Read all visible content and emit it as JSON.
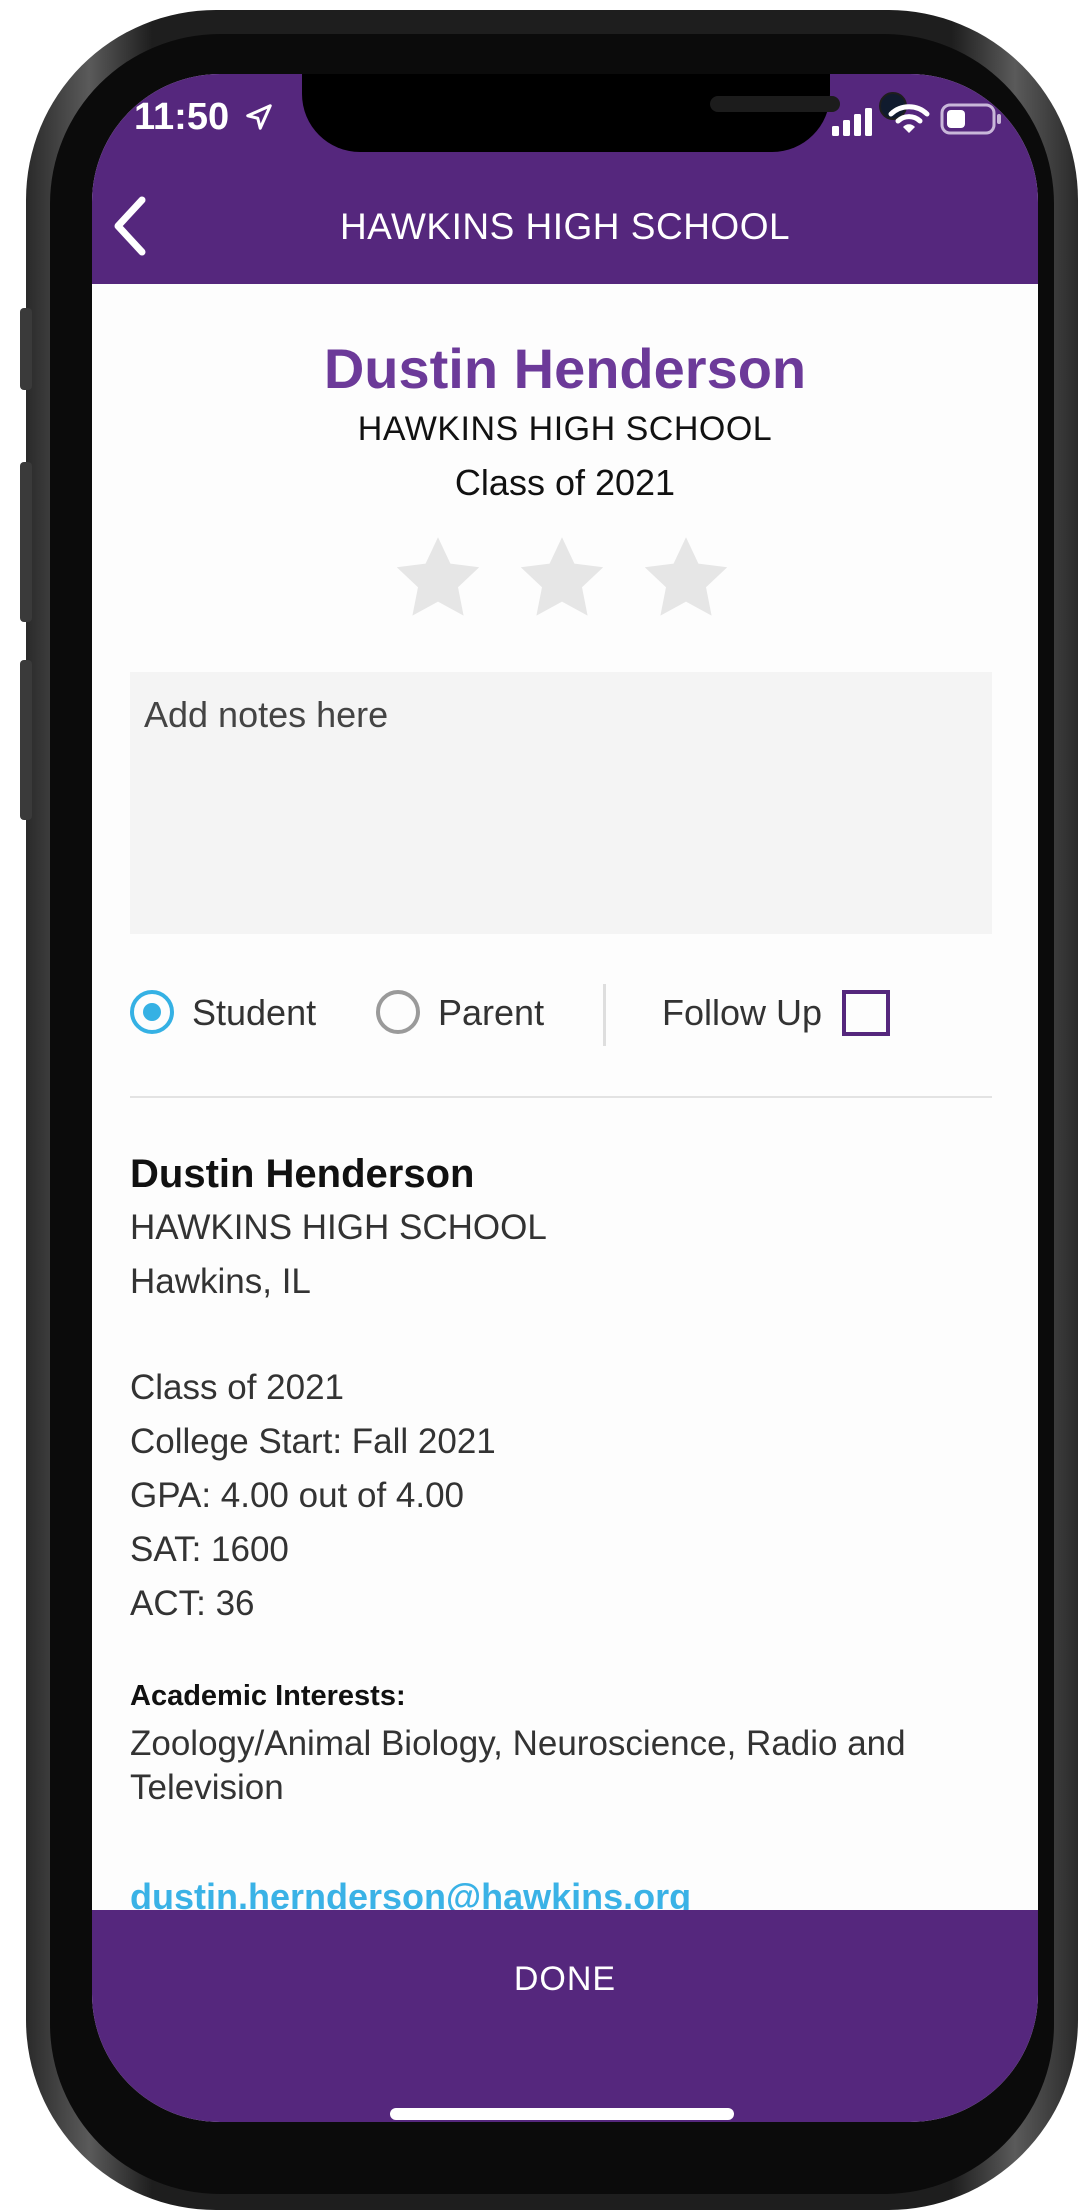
{
  "status_bar": {
    "time": "11:50"
  },
  "nav": {
    "title": "HAWKINS HIGH SCHOOL",
    "back_icon": "chevron-left-icon"
  },
  "profile": {
    "name": "Dustin Henderson",
    "school": "HAWKINS HIGH SCHOOL",
    "class_year": "Class of 2021",
    "rating": {
      "filled": 0,
      "max": 3
    }
  },
  "notes": {
    "placeholder": "Add notes here",
    "value": ""
  },
  "contact_type": {
    "options": [
      {
        "label": "Student",
        "selected": true
      },
      {
        "label": "Parent",
        "selected": false
      }
    ],
    "follow_up_label": "Follow Up",
    "follow_up_checked": false
  },
  "info": {
    "name": "Dustin Henderson",
    "school": "HAWKINS HIGH SCHOOL",
    "location": "Hawkins, IL",
    "class_year": "Class of 2021",
    "college_start": "College Start: Fall 2021",
    "gpa": "GPA: 4.00 out of 4.00",
    "sat": "SAT: 1600",
    "act": "ACT: 36",
    "interests_title": "Academic Interests:",
    "interests": "Zoology/Animal Biology, Neuroscience, Radio and Television",
    "email": "dustin.hernderson@hawkins.org"
  },
  "footer": {
    "done_label": "DONE"
  },
  "colors": {
    "brand_purple": "#55277d",
    "name_purple": "#6c3a99",
    "accent_blue": "#35b1e4",
    "star_gray": "#e6e6e6"
  }
}
